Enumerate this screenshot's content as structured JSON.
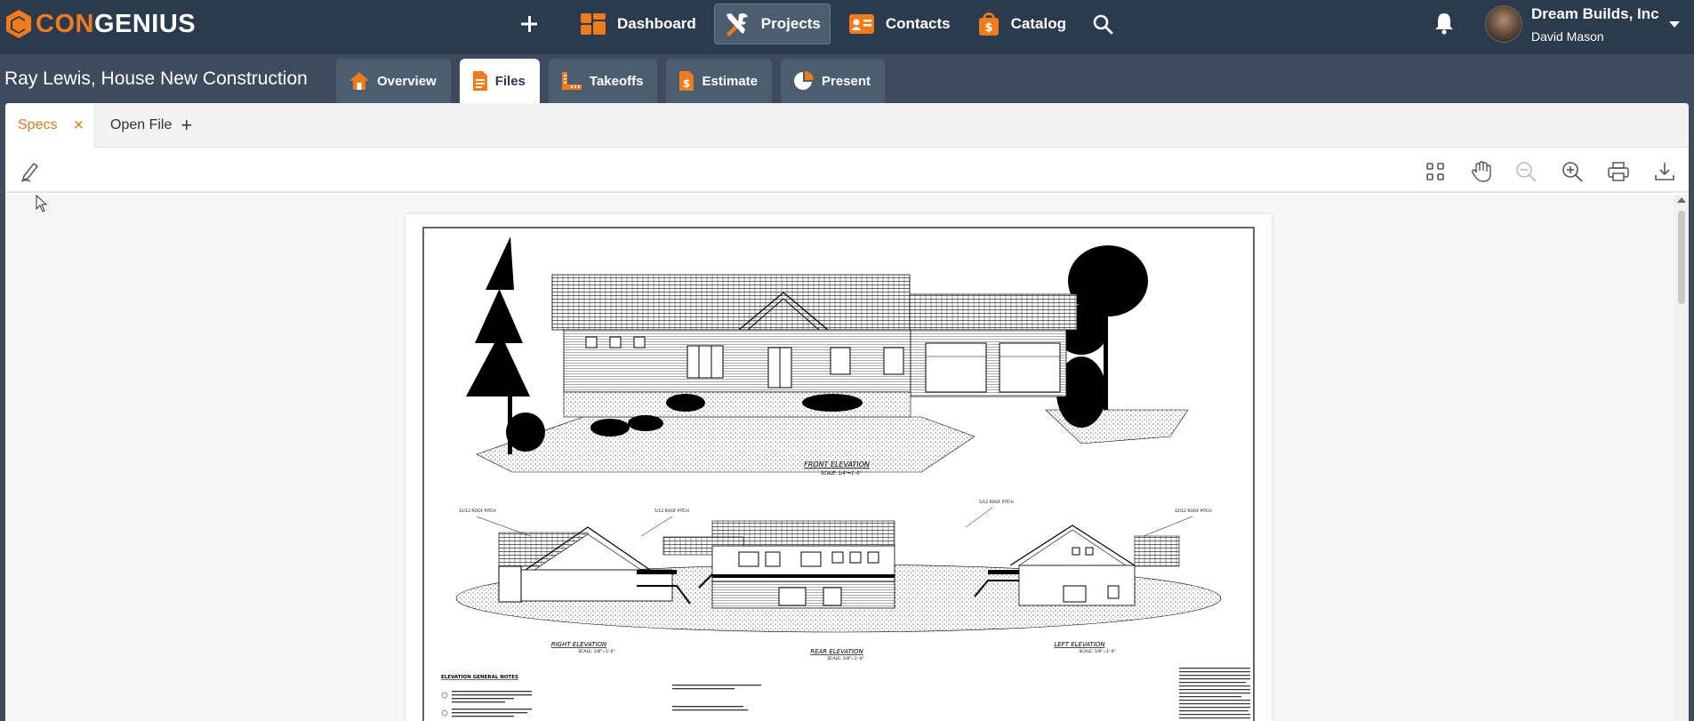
{
  "app": {
    "logo_left": "CON",
    "logo_right": "GENIUS"
  },
  "nav": {
    "items": [
      {
        "label": "Dashboard",
        "icon": "dashboard-icon"
      },
      {
        "label": "Projects",
        "icon": "tools-icon",
        "active": true
      },
      {
        "label": "Contacts",
        "icon": "contact-card-icon"
      },
      {
        "label": "Catalog",
        "icon": "catalog-bag-icon"
      }
    ]
  },
  "user": {
    "company": "Dream Builds, Inc",
    "name": "David Mason"
  },
  "project": {
    "title": "Ray Lewis, House New Construction",
    "tabs": [
      {
        "label": "Overview",
        "icon": "home-icon"
      },
      {
        "label": "Files",
        "icon": "file-icon",
        "active": true
      },
      {
        "label": "Takeoffs",
        "icon": "ruler-icon"
      },
      {
        "label": "Estimate",
        "icon": "estimate-dollar-icon"
      },
      {
        "label": "Present",
        "icon": "pie-chart-icon"
      }
    ]
  },
  "file_tabs": {
    "active": "Specs",
    "open_file": "Open File"
  },
  "drawing": {
    "front_label": "FRONT ELEVATION",
    "front_scale": "SCALE: 1/4\"=1'-0\"",
    "right_label": "RIGHT ELEVATION",
    "rear_label": "REAR ELEVATION",
    "left_label": "LEFT ELEVATION",
    "side_scale": "SCALE: 1/8\"=1'-0\"",
    "pitch_1": "12/12 ROOF PITCH",
    "pitch_2": "5/12 ROOF PITCH",
    "pitch_3": "5/12 ROOF PITCH",
    "pitch_4": "12/12 ROOF PITCH",
    "notes_title": "ELEVATION GENERAL NOTES"
  },
  "colors": {
    "topbar": "#2b3a4c",
    "accent": "#f07b1c"
  }
}
